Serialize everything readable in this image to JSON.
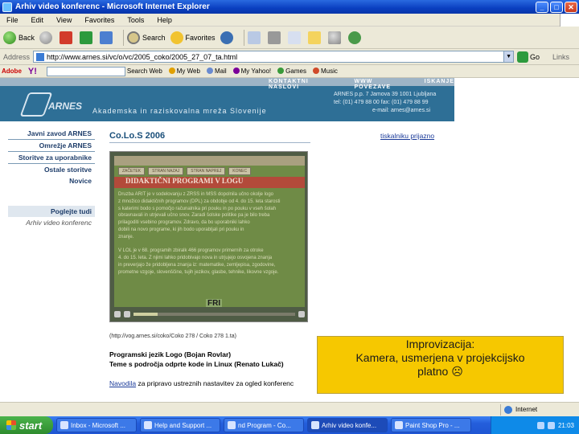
{
  "window": {
    "title": "Arhiv video konferenc - Microsoft Internet Explorer",
    "buttons": [
      "_",
      "□",
      "✕"
    ]
  },
  "menu": [
    "File",
    "Edit",
    "View",
    "Favorites",
    "Tools",
    "Help"
  ],
  "toolbar": {
    "back": "Back",
    "search": "Search",
    "favorites": "Favorites"
  },
  "address": {
    "label": "Address",
    "url": "http://www.arnes.si/vc/o/vc/2005_coko/2005_27_07_ta.html",
    "go": "Go",
    "links": "Links"
  },
  "yahoo": {
    "adobe": "Adobe",
    "logo": "Y!",
    "search_web": "Search Web",
    "my_web": "My Web",
    "mail": "Mail",
    "my_yahoo": "My Yahoo!",
    "games": "Games",
    "music": "Music"
  },
  "banner": {
    "nav": [
      "KONTAKTNI NASLOVI",
      "WWW POVEZAVE",
      "ISKANJE"
    ],
    "logo": "ARNES",
    "subtitle": "Akademska in raziskovalna mreža Slovenije",
    "contact_line1": "ARNES p.p. 7 Jamova 39 1001 Ljubljana",
    "contact_line2": "tel: (01) 479 88 00  fax: (01) 479 88 99",
    "contact_line3": "e-mail: arnes@arnes.si"
  },
  "sidenav": {
    "top": [
      "Javni zavod ARNES",
      "Omrežje ARNES",
      "Storitve za uporabnike",
      "Ostale storitve",
      "Novice"
    ],
    "bottom": [
      "Poglejte tudi",
      "Arhiv video konferenc"
    ]
  },
  "content": {
    "title": "Co.Lo.S 2006",
    "print_link": "tiskalniku prijazno",
    "video_url": "(http://vog.arnes.si/coko/Coko 278 / Coko 278 1.ta)",
    "heading1": "Programski jezik Logo (Bojan Rovlar)",
    "heading2": "Teme s področja odprte kode in Linux (Renato Lukač)",
    "note_link": "Navodila",
    "note_rest": " za pripravo ustreznih nastavitev za ogled konferenc"
  },
  "video": {
    "nav": [
      "ZAČETEK",
      "STRAN NAZAJ",
      "STRAN NAPREJ",
      "KONEC"
    ],
    "slide_title": "DIDAKTIČNI PROGRAMI V LOGU",
    "slide_text": "Druzba ARIT je v sodelovanju z ZRSŠ in MŠŠ dopolnila učno okolje logo\nz množico didaktičnih programov (DPL) za obdobje od 4. do 15. leta starosti\ns katerimi bodo s pomočjo računalnika pri pouku in po pouku v vseh šolah\nobravnavali in utrjevali učno snov. Zaradi šolske politike pa je bilo treba\nprilagoditi vsebino programov. Zdravo, da bo uporabniki lahko\ndobili na novo programe, ki jih bodo uporabljali pri pouku in\nznanje.\n\nV LOL je v 68. programih zbiralk 466 programov primernih za otroke\n4. do 15. leta. Z njimi lahko pridobivajo nova in utrjujejo osvojena znanja\nin preverjajo že pridobljena znanja iz: matematike, zemljepisa, zgodovine,\nprometne vzgoje, slovenščine, tujih jezikov, glasbe, tehnike, likovne vzgoje.",
    "caption": "FRI",
    "progress": 0.15
  },
  "callout": {
    "line1": "Improvizacija:",
    "line2": "Kamera, usmerjena v projekcijsko",
    "line3": "platno ☹"
  },
  "status": {
    "left": "",
    "zone": "Internet"
  },
  "taskbar": {
    "start": "start",
    "tasks": [
      "Inbox - Microsoft ...",
      "Help and Support ...",
      "nd Program - Co...",
      "Arhiv video konfe...",
      "Paint Shop Pro - ..."
    ],
    "clock": "21:03"
  }
}
